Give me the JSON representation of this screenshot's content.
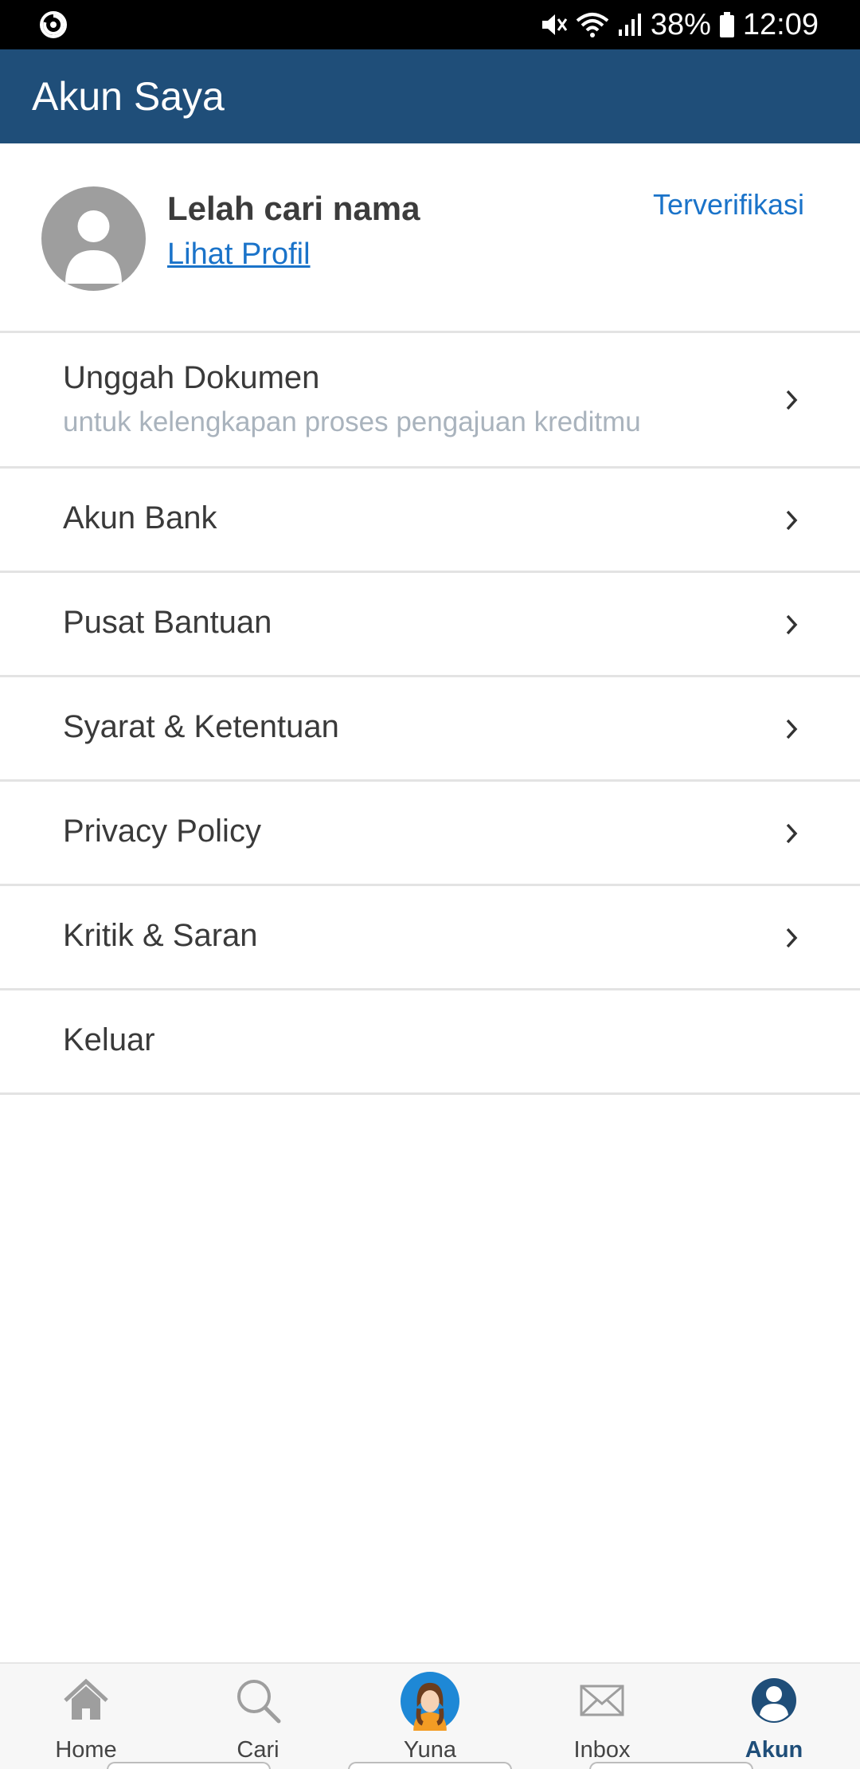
{
  "status_bar": {
    "battery": "38%",
    "time": "12:09",
    "icons": [
      "sync-icon",
      "mute-icon",
      "wifi-icon",
      "signal-icon",
      "battery-icon"
    ]
  },
  "app_bar": {
    "title": "Akun Saya"
  },
  "profile": {
    "name": "Lelah cari nama",
    "link": "Lihat Profil",
    "status": "Terverifikasi",
    "accent": "#1a73c9"
  },
  "menu": {
    "items": [
      {
        "label": "Unggah Dokumen",
        "sublabel": "untuk kelengkapan proses pengajuan kreditmu"
      },
      {
        "label": "Akun Bank"
      },
      {
        "label": "Pusat Bantuan"
      },
      {
        "label": "Syarat & Ketentuan"
      },
      {
        "label": "Privacy Policy"
      },
      {
        "label": "Kritik & Saran"
      },
      {
        "label": "Keluar"
      }
    ]
  },
  "bottom_nav": {
    "items": [
      {
        "label": "Home",
        "icon": "home-icon"
      },
      {
        "label": "Cari",
        "icon": "search-icon"
      },
      {
        "label": "Yuna",
        "icon": "yuna-avatar-icon"
      },
      {
        "label": "Inbox",
        "icon": "mail-icon"
      },
      {
        "label": "Akun",
        "icon": "account-icon",
        "active": true
      }
    ]
  },
  "colors": {
    "primary": "#1f4e79",
    "link": "#1a73c9",
    "divider": "#e3e3e3",
    "muted_text": "#a9b3bd"
  }
}
